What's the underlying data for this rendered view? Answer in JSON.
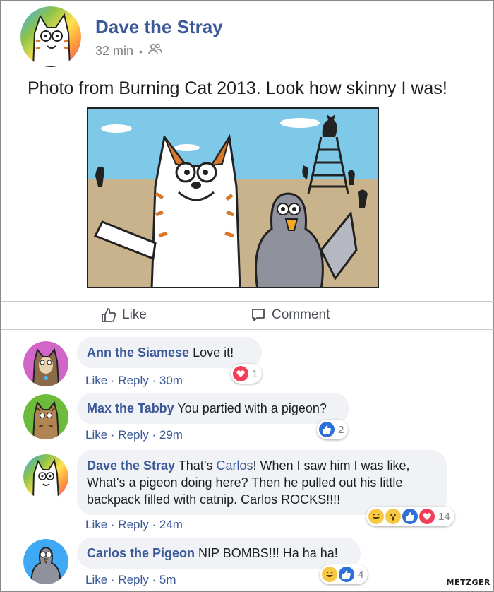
{
  "post": {
    "author": "Dave the Stray",
    "time": "32 min",
    "separator": "•",
    "audience_icon": "friends-icon",
    "text": "Photo from Burning Cat 2013. Look how skinny I was!",
    "photo_icon": "cartoon-selfie-photo"
  },
  "actions": {
    "like_label": "Like",
    "comment_label": "Comment"
  },
  "comments": [
    {
      "author": "Ann the Siamese",
      "text": "Love it!",
      "like": "Like",
      "reply": "Reply",
      "time": "30m",
      "reactions": [
        "love"
      ],
      "reaction_count": "1"
    },
    {
      "author": "Max the Tabby",
      "text": "You partied with a pigeon?",
      "like": "Like",
      "reply": "Reply",
      "time": "29m",
      "reactions": [
        "like"
      ],
      "reaction_count": "2"
    },
    {
      "author": "Dave the Stray",
      "text_before": "That’s ",
      "link": "Carlos",
      "text_after": "! When I saw him I was like, What's a pigeon doing here? Then he pulled out his little backpack filled with catnip. Carlos ROCKS!!!!",
      "like": "Like",
      "reply": "Reply",
      "time": "24m",
      "reactions": [
        "haha",
        "wow",
        "like",
        "love"
      ],
      "reaction_count": "14"
    },
    {
      "author": "Carlos the Pigeon",
      "text": "NIP BOMBS!!! Ha ha ha!",
      "like": "Like",
      "reply": "Reply",
      "time": "5m",
      "reactions": [
        "haha",
        "like"
      ],
      "reaction_count": "4"
    }
  ],
  "colors": {
    "link_blue": "#3b5998",
    "bubble_bg": "#f0f2f5",
    "love_red": "#f33e58",
    "like_blue": "#2e6fd8",
    "haha_yellow": "#f7c843"
  },
  "signature": "METZGER"
}
